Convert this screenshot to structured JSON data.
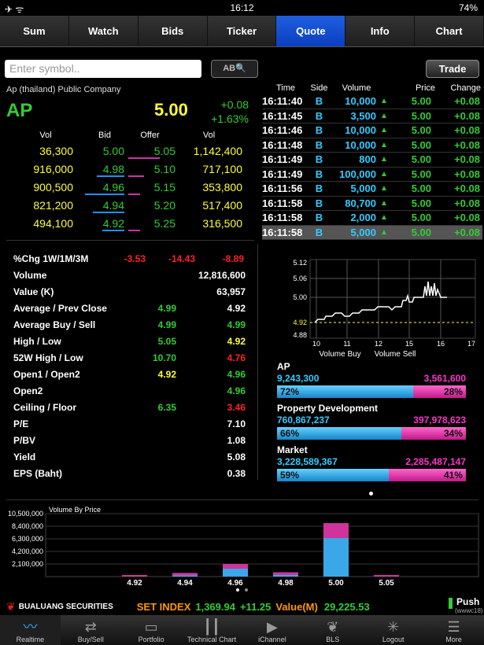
{
  "status": {
    "left": "✈ ᯤ",
    "time": "16:12",
    "battery": "74%"
  },
  "tabs": [
    "Sum",
    "Watch",
    "Bids",
    "Ticker",
    "Quote",
    "Info",
    "Chart"
  ],
  "search": {
    "placeholder": "Enter symbol..",
    "abq": "AB🔍",
    "trade": "Trade"
  },
  "quote": {
    "company": "Ap (thailand) Public Company",
    "symbol": "AP",
    "price": "5.00",
    "change": "+0.08",
    "pct": "+1.63%"
  },
  "book": {
    "headers": [
      "Vol",
      "Bid",
      "Offer",
      "Vol"
    ],
    "rows": [
      [
        "36,300",
        "5.00",
        "5.05",
        "1,142,400"
      ],
      [
        "916,000",
        "4.98",
        "5.10",
        "717,100"
      ],
      [
        "900,500",
        "4.96",
        "5.15",
        "353,800"
      ],
      [
        "821,200",
        "4.94",
        "5.20",
        "517,400"
      ],
      [
        "494,100",
        "4.92",
        "5.25",
        "316,500"
      ]
    ],
    "colors": {
      "bid": "#33cc33",
      "vol": "#ffff33",
      "bidBar": "#1e90ff",
      "offerBar": "#cc33aa"
    }
  },
  "ticker": {
    "headers": [
      "Time",
      "Side",
      "Volume",
      "Price",
      "Change"
    ],
    "rows": [
      [
        "16:11:40",
        "B",
        "10,000",
        "5.00",
        "+0.08"
      ],
      [
        "16:11:45",
        "B",
        "3,500",
        "5.00",
        "+0.08"
      ],
      [
        "16:11:46",
        "B",
        "10,000",
        "5.00",
        "+0.08"
      ],
      [
        "16:11:48",
        "B",
        "10,000",
        "5.00",
        "+0.08"
      ],
      [
        "16:11:49",
        "B",
        "800",
        "5.00",
        "+0.08"
      ],
      [
        "16:11:49",
        "B",
        "100,000",
        "5.00",
        "+0.08"
      ],
      [
        "16:11:56",
        "B",
        "5,000",
        "5.00",
        "+0.08"
      ],
      [
        "16:11:58",
        "B",
        "80,700",
        "5.00",
        "+0.08"
      ],
      [
        "16:11:58",
        "B",
        "2,000",
        "5.00",
        "+0.08"
      ],
      [
        "16:11:58",
        "B",
        "5,000",
        "5.00",
        "+0.08"
      ]
    ]
  },
  "stats": [
    {
      "label": "%Chg 1W/1M/3M",
      "v": [
        "-3.53",
        "-14.43",
        "-8.89"
      ],
      "c": [
        "#ff2222",
        "#ff2222",
        "#ff2222"
      ]
    },
    {
      "label": "Volume",
      "v": [
        "",
        "",
        "12,816,600"
      ],
      "c": [
        "",
        "",
        "#fff"
      ]
    },
    {
      "label": "Value (K)",
      "v": [
        "",
        "",
        "63,957"
      ],
      "c": [
        "",
        "",
        "#fff"
      ]
    },
    {
      "label": "Average / Prev Close",
      "v": [
        "",
        "4.99",
        "4.92"
      ],
      "c": [
        "",
        "#33cc33",
        "#fff"
      ]
    },
    {
      "label": "Average Buy / Sell",
      "v": [
        "",
        "4.99",
        "4.99"
      ],
      "c": [
        "",
        "#33cc33",
        "#33cc33"
      ]
    },
    {
      "label": "High / Low",
      "v": [
        "",
        "5.05",
        "4.92"
      ],
      "c": [
        "",
        "#33cc33",
        "#ffff33"
      ]
    },
    {
      "label": "52W High / Low",
      "v": [
        "",
        "10.70",
        "4.76"
      ],
      "c": [
        "",
        "#33cc33",
        "#ff2222"
      ]
    },
    {
      "label": "Open1 / Open2",
      "v": [
        "",
        "4.92",
        "4.96"
      ],
      "c": [
        "",
        "#ffff33",
        "#33cc33"
      ]
    },
    {
      "label": "Open2",
      "v": [
        "",
        "",
        "4.96"
      ],
      "c": [
        "",
        "",
        "#33cc33"
      ]
    },
    {
      "label": "Ceiling / Floor",
      "v": [
        "",
        "6.35",
        "3.46"
      ],
      "c": [
        "",
        "#33cc33",
        "#ff2222"
      ]
    },
    {
      "label": "P/E",
      "v": [
        "",
        "",
        "7.10"
      ],
      "c": [
        "",
        "",
        "#fff"
      ]
    },
    {
      "label": "P/BV",
      "v": [
        "",
        "",
        "1.08"
      ],
      "c": [
        "",
        "",
        "#fff"
      ]
    },
    {
      "label": "Yield",
      "v": [
        "",
        "",
        "5.08"
      ],
      "c": [
        "",
        "",
        "#fff"
      ]
    },
    {
      "label": "EPS (Baht)",
      "v": [
        "",
        "",
        "0.38"
      ],
      "c": [
        "",
        "",
        "#fff"
      ]
    }
  ],
  "intraday": {
    "yticks": [
      "5.12",
      "5.06",
      "5.00",
      "4.92",
      "4.88"
    ],
    "xticks": [
      "10",
      "11",
      "12",
      "15",
      "16",
      "17"
    ],
    "legend": [
      "Volume Buy",
      "Volume Sell"
    ]
  },
  "ratios": [
    {
      "name": "AP",
      "buy": "9,243,300",
      "sell": "3,561,600",
      "bp": "72%",
      "sp": "28%",
      "bf": 0.72
    },
    {
      "name": "Property Development",
      "buy": "760,867,237",
      "sell": "397,978,623",
      "bp": "66%",
      "sp": "34%",
      "bf": 0.66
    },
    {
      "name": "Market",
      "buy": "3,228,589,367",
      "sell": "2,285,487,147",
      "bp": "59%",
      "sp": "41%",
      "bf": 0.59
    }
  ],
  "chart_data": {
    "type": "bar",
    "title": "Volume By Price",
    "categories": [
      "4.92",
      "4.94",
      "4.96",
      "4.98",
      "5.00",
      "5.05"
    ],
    "series": [
      {
        "values": [
          200000,
          600000,
          2100000,
          700000,
          8900000,
          100000
        ]
      }
    ],
    "yticks": [
      "10,500,000",
      "8,400,000",
      "6,300,000",
      "4,200,000",
      "2,100,000"
    ],
    "ylim": [
      0,
      10500000
    ]
  },
  "footer": {
    "brand": "BUALUANG SECURITIES",
    "index": "SET INDEX",
    "indexVal": "1,369.94",
    "indexChg": "+11.25",
    "valueLabel": "Value(M)",
    "value": "29,225.53",
    "push": "Push",
    "pushSub": "(wwwc18)"
  },
  "nav": [
    "Realtime",
    "Buy/Sell",
    "Portfolio",
    "Technical Chart",
    "iChannel",
    "BLS",
    "Logout",
    "More"
  ]
}
